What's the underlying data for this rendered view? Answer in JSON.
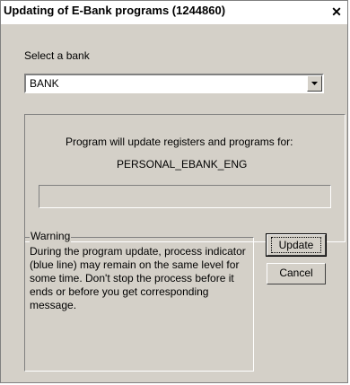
{
  "window": {
    "title": "Updating of E-Bank programs (1244860)",
    "close_glyph": "✕"
  },
  "bank_select": {
    "label": "Select a bank",
    "value": "BANK"
  },
  "info": {
    "message": "Program will update registers and programs for:",
    "target": "PERSONAL_EBANK_ENG",
    "progress_fraction": 0
  },
  "warning": {
    "title": "Warning",
    "text": "During the program update, process indicator (blue line) may remain on the same level for some time. Don't stop the process before it ends or before you get corresponding message."
  },
  "buttons": {
    "update": "Update",
    "cancel": "Cancel"
  },
  "colors": {
    "dialog_bg": "#d4d0c8",
    "progress": "#0a246a"
  }
}
